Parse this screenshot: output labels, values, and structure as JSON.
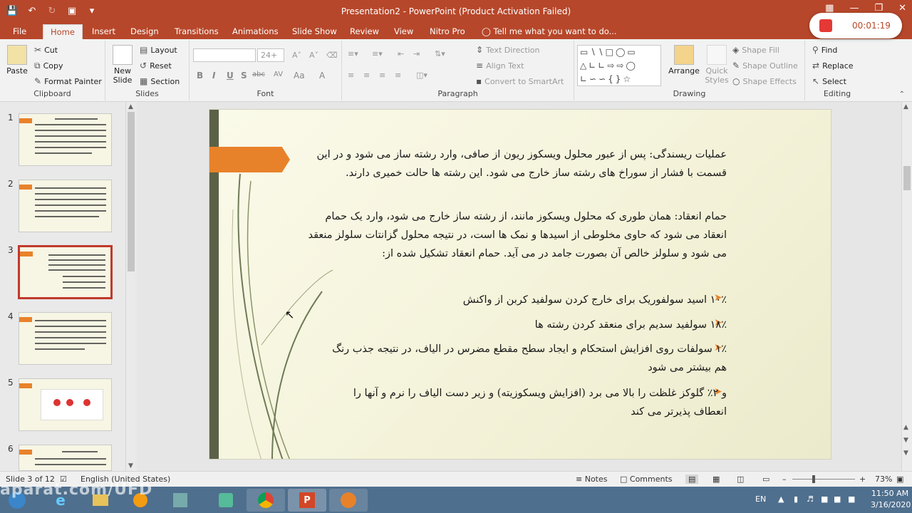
{
  "window": {
    "title": "Presentation2 - PowerPoint (Product Activation Failed)",
    "minimize": "—",
    "restore": "❐",
    "close": "✕"
  },
  "recorder": {
    "time": "00:01:19"
  },
  "tabs": [
    {
      "label": "File"
    },
    {
      "label": "Home"
    },
    {
      "label": "Insert"
    },
    {
      "label": "Design"
    },
    {
      "label": "Transitions"
    },
    {
      "label": "Animations"
    },
    {
      "label": "Slide Show"
    },
    {
      "label": "Review"
    },
    {
      "label": "View"
    },
    {
      "label": "Nitro Pro"
    }
  ],
  "tell_me": "Tell me what you want to do...",
  "ribbon": {
    "clipboard": {
      "paste": "Paste",
      "cut": "Cut",
      "copy": "Copy",
      "format_painter": "Format Painter",
      "label": "Clipboard"
    },
    "slides": {
      "new_slide": "New Slide",
      "layout": "Layout",
      "reset": "Reset",
      "section": "Section",
      "label": "Slides"
    },
    "font": {
      "size": "24+",
      "label": "Font",
      "b": "B",
      "i": "I",
      "u": "U",
      "s": "S",
      "ab": "abc",
      "av": "AV",
      "aa": "Aa",
      "a": "A"
    },
    "paragraph": {
      "text_direction": "Text Direction",
      "align_text": "Align Text",
      "convert": "Convert to SmartArt",
      "label": "Paragraph"
    },
    "drawing": {
      "arrange": "Arrange",
      "quick_styles": "Quick Styles",
      "shape_fill": "Shape Fill",
      "shape_outline": "Shape Outline",
      "shape_effects": "Shape Effects",
      "label": "Drawing"
    },
    "editing": {
      "find": "Find",
      "replace": "Replace",
      "select": "Select",
      "label": "Editing"
    }
  },
  "thumbnails": [
    {
      "num": "1"
    },
    {
      "num": "2"
    },
    {
      "num": "3"
    },
    {
      "num": "4"
    },
    {
      "num": "5"
    },
    {
      "num": "6"
    }
  ],
  "slide": {
    "para1": "عملیات ریسندگی: پس از عبور محلول ویسکوز ریون از صافی، وارد رشته ساز می شود و در این قسمت با فشار از سوراخ های رشته ساز خارج می شود. این رشته ها حالت خمیری دارند.",
    "para2": "حمام انعقاد: همان طوری که محلول ویسکوز مانند، از رشته ساز خارج می شود، وارد یک حمام انعقاد می شود که حاوی مخلوطی از اسیدها و نمک ها است، در نتیجه محلول گزانتات سلولز منعقد می شود و سلولز خالص آن بصورت جامد در می آید. حمام انعقاد تشکیل شده از:",
    "bullets": [
      "۱۰٪ اسید سولفوریک برای خارج کردن سولفید کربن از واکنش",
      "۱۸٪ سولفید سدیم برای منعقد کردن رشته ها",
      "۱٪ سولفات روی افزایش استحکام و ایجاد سطح مقطع مضرس در الیاف، در نتیجه جذب رنگ هم بیشتر می شود",
      "و ۲٪ گلوکز غلظت را بالا می برد (افزایش ویسکوزیته) و زیر دست الیاف را نرم و آنها را انعطاف پذیرتر می کند"
    ]
  },
  "status": {
    "slide": "Slide 3 of 12",
    "language": "English (United States)",
    "notes": "Notes",
    "comments": "Comments",
    "zoom": "73%"
  },
  "taskbar": {
    "lang": "EN",
    "time": "11:50 AM",
    "date": "3/16/2020"
  },
  "watermark": "aparat.com/UFD"
}
